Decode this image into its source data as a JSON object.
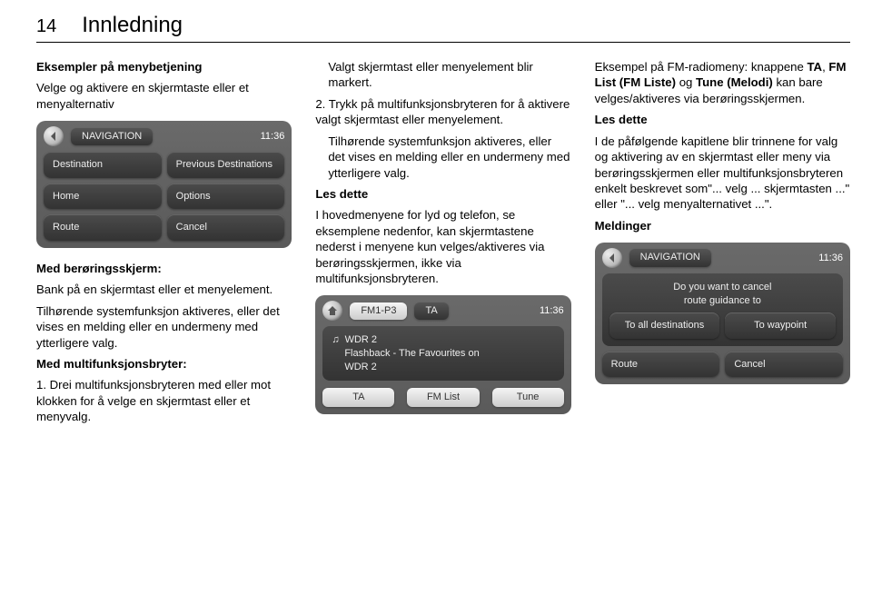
{
  "page_number": "14",
  "section_title": "Innledning",
  "col1": {
    "heading": "Eksempler på menybetjening",
    "p1": "Velge og aktivere en skjermtaste eller et menyalternativ",
    "touch_head": "Med berøringsskjerm:",
    "touch_p1": "Bank på en skjermtast eller et menyelement.",
    "touch_p2": "Tilhørende systemfunksjon aktiveres, eller det vises en melding eller en undermeny med ytterligere valg.",
    "multi_head": "Med multifunksjonsbryter:",
    "multi_l1": "1. Drei multifunksjonsbryteren med eller mot klokken for å velge en skjermtast eller et menyvalg."
  },
  "device1": {
    "tab": "NAVIGATION",
    "clock": "11:36",
    "btns": [
      "Destination",
      "Previous Destinations",
      "Home",
      "Options",
      "Route",
      "Cancel"
    ]
  },
  "col2": {
    "p1": "Valgt skjermtast eller menyelement blir markert.",
    "p2": "2. Trykk på multifunksjonsbryteren for å aktivere valgt skjermtast eller menyelement.",
    "p3": "Tilhørende systemfunksjon aktiveres, eller det vises en melding eller en undermeny med ytterligere valg.",
    "les_head": "Les dette",
    "les_body": "I hovedmenyene for lyd og telefon, se eksemplene nedenfor, kan skjermtastene nederst i menyene kun velges/aktiveres via berøringsskjermen, ikke via multifunksjonsbryteren."
  },
  "device2": {
    "tab1": "FM1-P3",
    "tab2": "TA",
    "clock": "11:36",
    "station": "WDR 2",
    "info1": "Flashback - The Favourites on",
    "info2": "WDR 2",
    "bottom": [
      "TA",
      "FM List",
      "Tune"
    ]
  },
  "col3": {
    "p1a": "Eksempel på FM-radiomeny: knappene ",
    "p1b": "TA",
    "p1c": ", ",
    "p1d": "FM List (FM Liste)",
    "p1e": " og ",
    "p1f": "Tune (Melodi)",
    "p1g": " kan bare velges/aktiveres via berøringsskjermen.",
    "les_head": "Les dette",
    "les_body": "I de påfølgende kapitlene blir trinnene for valg og aktivering av en skjermtast eller meny via berøringsskjermen eller multifunksjonsbryteren enkelt beskrevet som\"... velg ... skjermtasten ...\" eller \"... velg menyalternativet ...\".",
    "meldinger": "Meldinger"
  },
  "device3": {
    "tab": "NAVIGATION",
    "clock": "11:36",
    "q1": "Do you want to cancel",
    "q2": "route guidance to",
    "b1": "To all destinations",
    "b2": "To waypoint",
    "b3": "Route",
    "b4": "Cancel"
  }
}
